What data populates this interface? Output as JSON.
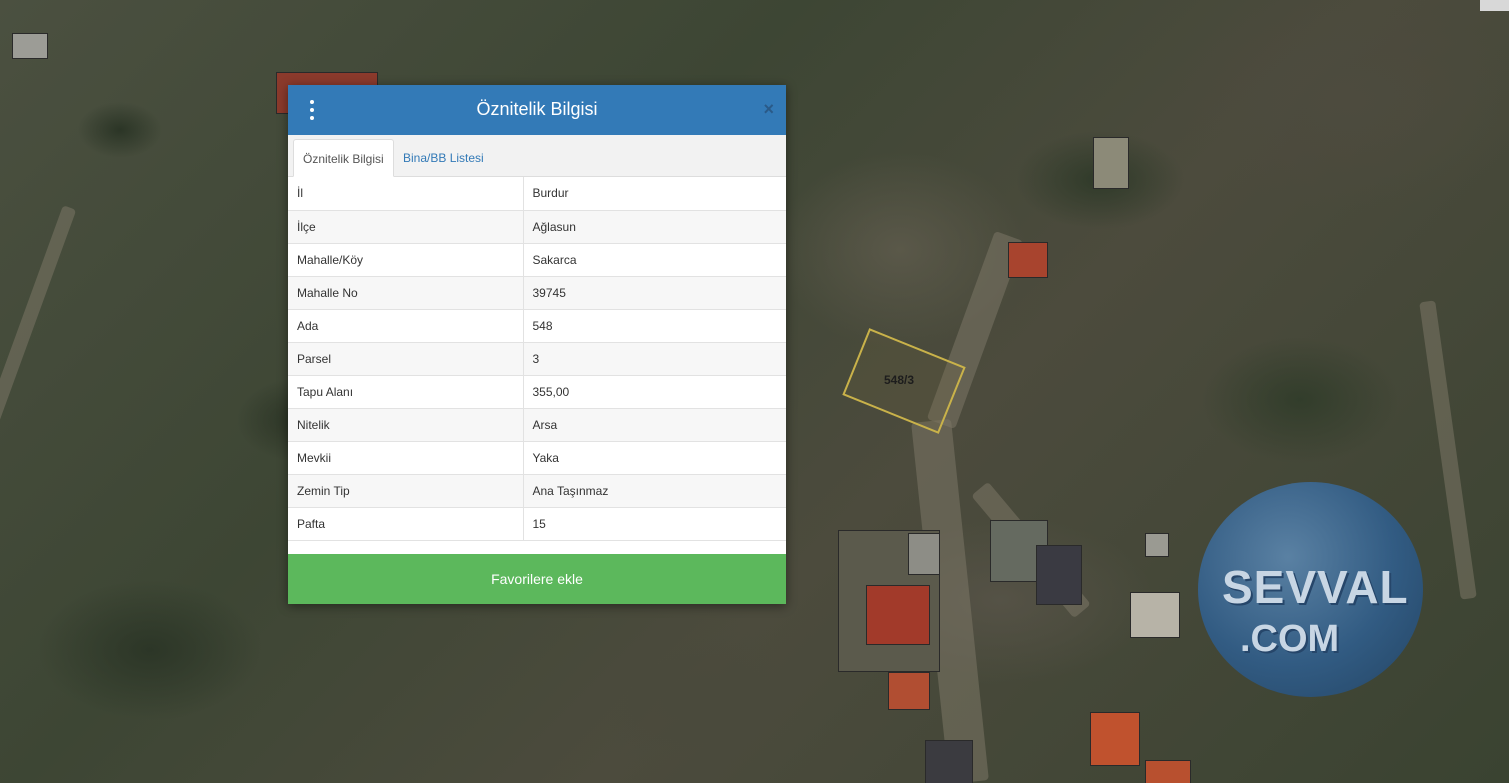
{
  "dialog": {
    "title": "Öznitelik Bilgisi",
    "close_symbol": "×",
    "tabs": [
      {
        "label": "Öznitelik Bilgisi",
        "active": true
      },
      {
        "label": "Bina/BB Listesi",
        "active": false
      }
    ],
    "rows": [
      {
        "key": "İl",
        "value": "Burdur"
      },
      {
        "key": "İlçe",
        "value": "Ağlasun"
      },
      {
        "key": "Mahalle/Köy",
        "value": "Sakarca"
      },
      {
        "key": "Mahalle No",
        "value": "39745"
      },
      {
        "key": "Ada",
        "value": "548"
      },
      {
        "key": "Parsel",
        "value": "3"
      },
      {
        "key": "Tapu Alanı",
        "value": "355,00"
      },
      {
        "key": "Nitelik",
        "value": "Arsa"
      },
      {
        "key": "Mevkii",
        "value": "Yaka"
      },
      {
        "key": "Zemin Tip",
        "value": "Ana Taşınmaz"
      },
      {
        "key": "Pafta",
        "value": "15"
      }
    ],
    "favorite_button": "Favorilere ekle"
  },
  "map": {
    "parcel_label": "548/3",
    "parcel_color": "#c9b24a"
  },
  "watermark": {
    "line1": "SEVVAL",
    "line2": ".COM"
  },
  "colors": {
    "header": "#337ab7",
    "button": "#5cb85c"
  }
}
